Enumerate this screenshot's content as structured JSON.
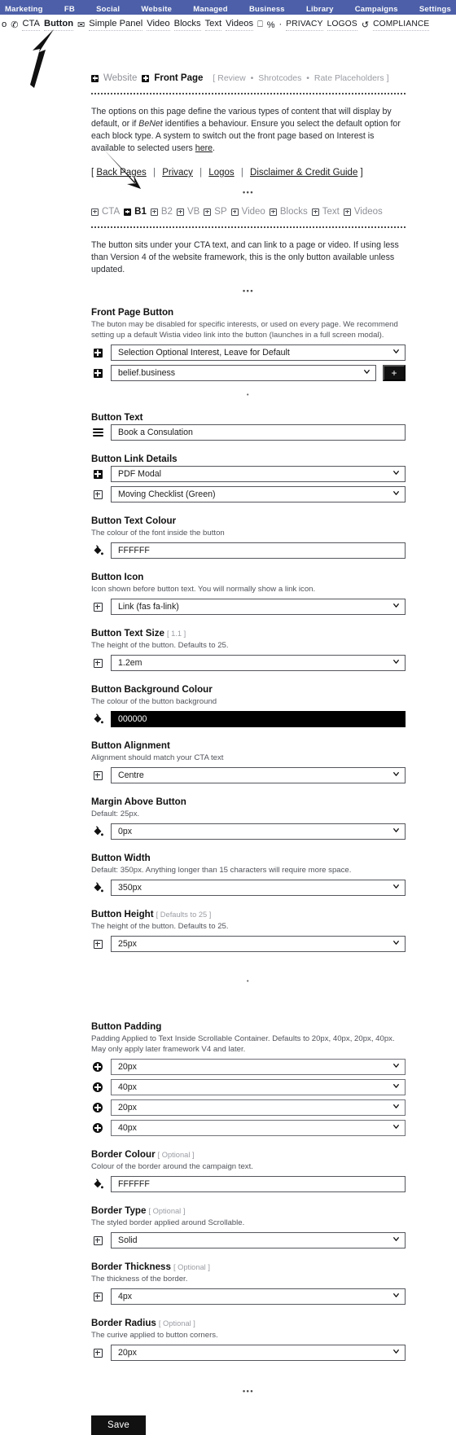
{
  "topnav": {
    "items": [
      {
        "label": "Marketing"
      },
      {
        "label": "FB"
      },
      {
        "label": "Social"
      },
      {
        "label": "Website"
      },
      {
        "label": "Managed"
      },
      {
        "label": "Business"
      },
      {
        "label": "Library"
      },
      {
        "label": "Campaigns"
      },
      {
        "label": "Settings"
      }
    ],
    "background_color": "#4c5fa8",
    "text_color": "#ffffff"
  },
  "toolbar": {
    "truncated_first": "o",
    "phone_icon": "✆",
    "items": [
      {
        "label": "CTA",
        "bold": false
      },
      {
        "label": "Button",
        "bold": true
      }
    ],
    "envelope_icon": "✉",
    "items2": [
      {
        "label": "Simple Panel"
      },
      {
        "label": "Video"
      },
      {
        "label": "Blocks"
      },
      {
        "label": "Text"
      },
      {
        "label": "Videos"
      }
    ],
    "monitor_icon": "⎕",
    "percent_icon": "%",
    "dot": "·",
    "items3": [
      {
        "label": "PRIVACY"
      },
      {
        "label": "LOGOS"
      }
    ],
    "undo_icon": "↺",
    "items4": [
      {
        "label": "COMPLIANCE"
      }
    ]
  },
  "breadcrumbs": {
    "website_label": "Website",
    "front_page_label": "Front Page",
    "meta": [
      "Review",
      "Shrotcodes",
      "Rate Placeholders"
    ],
    "meta_open": "[",
    "meta_close": "]",
    "meta_sep": "•"
  },
  "intro": {
    "text_1": "The options on this page define the various types of content that will display by default, or if ",
    "emphasis": "BeNet",
    "text_2": " identifies a behaviour. Ensure you select the default option for each block type. A system to switch out the front page based on Interest is available to selected users ",
    "link": "here",
    "text_3": "."
  },
  "page_links": {
    "open": "[",
    "close": "]",
    "items": [
      "Back Pages",
      "Privacy",
      "Logos",
      "Disclaimer & Credit Guide"
    ],
    "separator": "|"
  },
  "block_tabs": {
    "items": [
      {
        "label": "CTA",
        "active": false
      },
      {
        "label": "B1",
        "active": true
      },
      {
        "label": "B2",
        "active": false
      },
      {
        "label": "VB",
        "active": false
      },
      {
        "label": "SP",
        "active": false
      },
      {
        "label": "Video",
        "active": false
      },
      {
        "label": "Blocks",
        "active": false
      },
      {
        "label": "Text",
        "active": false
      },
      {
        "label": "Videos",
        "active": false
      }
    ]
  },
  "block_description": "The button sits under your CTA text, and can link to a page or video. If using less than Version 4 of the website framework, this is the only button available unless updated.",
  "ellipsis_glyph": "•••",
  "dot_glyph": "•",
  "fields": {
    "front_page_button": {
      "title": "Front Page Button",
      "help": "The buton may be disabled for specific interests, or used on every page. We recommend setting up a default Wistia video link into the button (launches in a full screen modal).",
      "interest_select": "Selection Optional Interest, Leave for Default",
      "belief_select": "belief.business",
      "add_button_label": "+"
    },
    "button_text": {
      "title": "Button Text",
      "value": "Book a Consulation"
    },
    "button_link_details": {
      "title": "Button Link Details",
      "link_type": "PDF Modal",
      "link_target": "Moving Checklist (Green)"
    },
    "button_text_colour": {
      "title": "Button Text Colour",
      "help": "The colour of the font inside the button",
      "value": "FFFFFF"
    },
    "button_icon": {
      "title": "Button Icon",
      "help": "Icon shown before button text. You will normally show a link icon.",
      "value": "Link (fas fa-link)"
    },
    "button_text_size": {
      "title": "Button Text Size",
      "badge": "[ 1.1 ]",
      "help": "The height of the button. Defaults to 25.",
      "value": "1.2em"
    },
    "button_background_colour": {
      "title": "Button Background Colour",
      "help": "The colour of the button background",
      "value": "000000",
      "swatch": "#000000"
    },
    "button_alignment": {
      "title": "Button Alignment",
      "help": "Alignment should match your CTA text",
      "value": "Centre"
    },
    "margin_above_button": {
      "title": "Margin Above Button",
      "help": "Default: 25px.",
      "value": "0px"
    },
    "button_width": {
      "title": "Button Width",
      "help": "Default: 350px. Anything longer than 15 characters will require more space.",
      "value": "350px"
    },
    "button_height": {
      "title": "Button Height",
      "badge": "[ Defaults to 25 ]",
      "help": "The height of the button. Defaults to 25.",
      "value": "25px"
    },
    "button_padding": {
      "title": "Button Padding",
      "help": "Padding Applied to Text Inside Scrollable Container. Defaults to 20px, 40px, 20px, 40px. May only apply later framework V4 and later.",
      "values": [
        "20px",
        "40px",
        "20px",
        "40px"
      ]
    },
    "border_colour": {
      "title": "Border Colour",
      "badge": "[ Optional ]",
      "help": "Colour of the border around the campaign text.",
      "value": "FFFFFF"
    },
    "border_type": {
      "title": "Border Type",
      "badge": "[ Optional ]",
      "help": "The styled border applied around Scrollable.",
      "value": "Solid"
    },
    "border_thickness": {
      "title": "Border Thickness",
      "badge": "[ Optional ]",
      "help": "The thickness of the border.",
      "value": "4px"
    },
    "border_radius": {
      "title": "Border Radius",
      "badge": "[ Optional ]",
      "help": "The curive applied to button corners.",
      "value": "20px"
    }
  },
  "save": {
    "label": "Save"
  }
}
